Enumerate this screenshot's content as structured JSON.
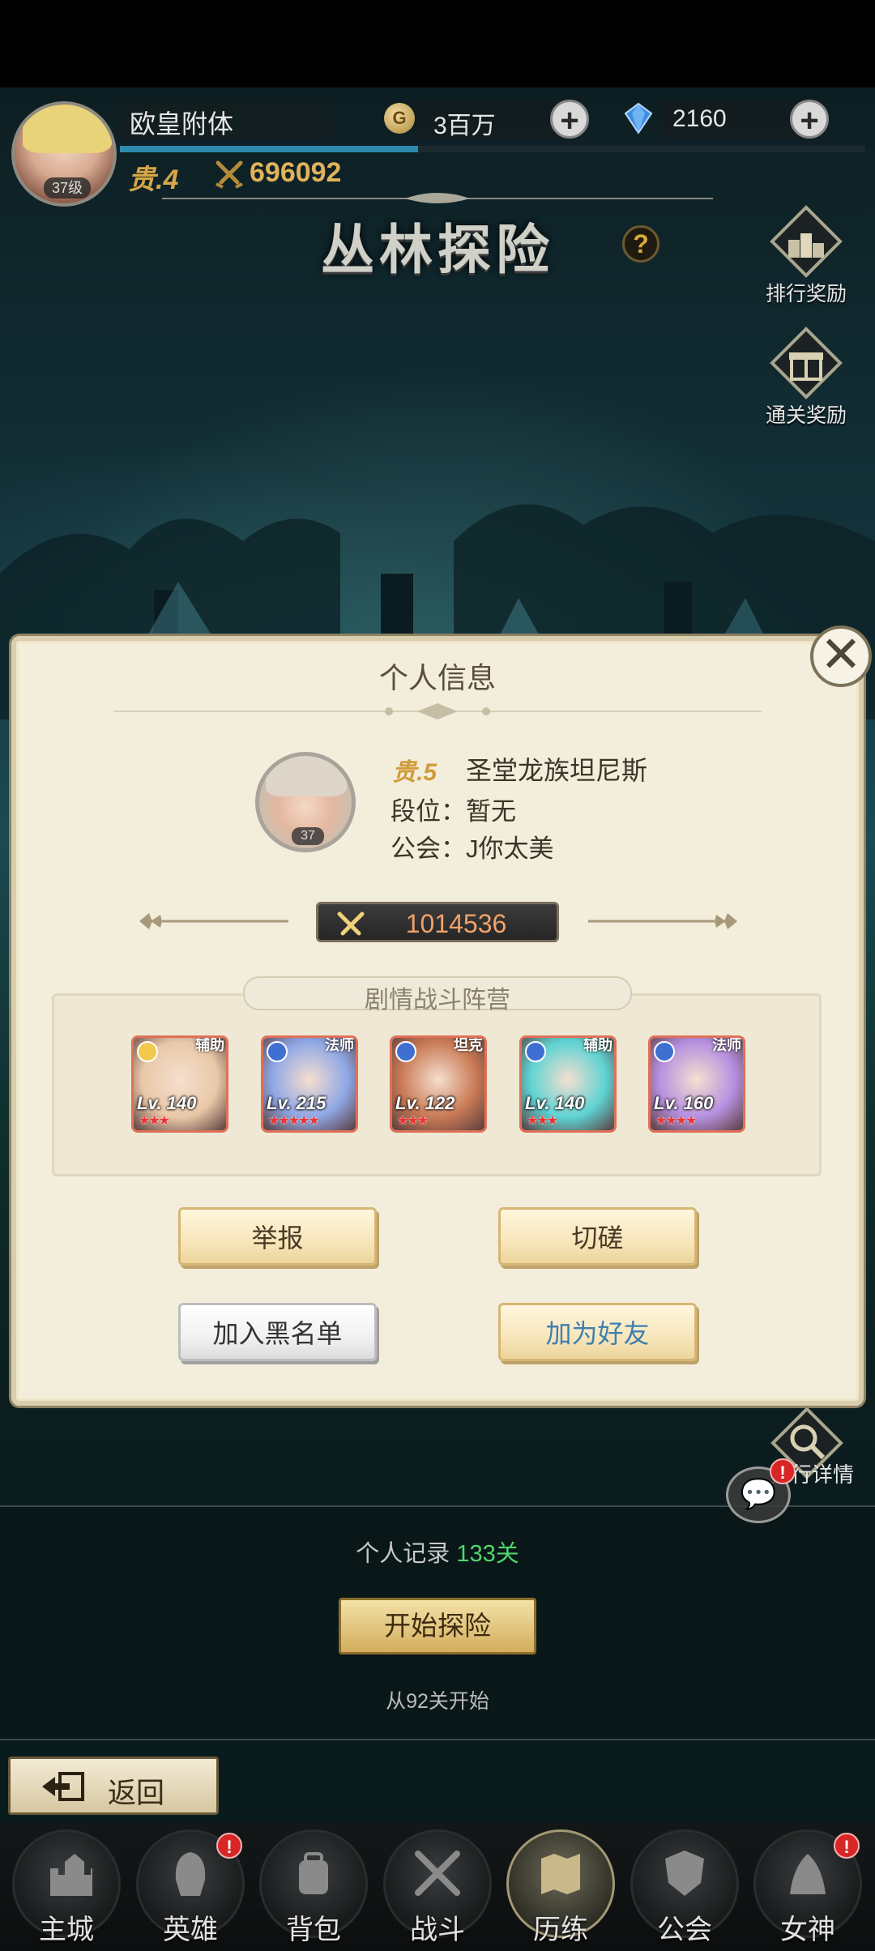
{
  "header": {
    "player_name": "欧皇附体",
    "avatar_level": "37级",
    "vip": "贵.4",
    "power": "696092",
    "gold": "3百万",
    "gold_icon": "G",
    "diamonds": "2160",
    "exp_progress": 0.4
  },
  "page": {
    "title": "丛林探险",
    "help": "?",
    "side_buttons": [
      "排行奖励",
      "通关奖励"
    ]
  },
  "modal": {
    "title": "个人信息",
    "player": {
      "vip": "贵.5",
      "name": "圣堂龙族坦尼斯",
      "rank_label": "段位：暂无",
      "guild_label": "公会：J你太美",
      "avatar_level": "37"
    },
    "power": "1014536",
    "lineup_title": "剧情战斗阵营",
    "heroes": [
      {
        "role": "辅助",
        "level": "Lv. 140",
        "stars": "★★★",
        "color": "#e9c8a8"
      },
      {
        "role": "法师",
        "level": "Lv. 215",
        "stars": "★★★★★",
        "color": "#8fa7e6"
      },
      {
        "role": "坦克",
        "level": "Lv. 122",
        "stars": "★★★",
        "color": "#c97a55"
      },
      {
        "role": "辅助",
        "level": "Lv. 140",
        "stars": "★★★",
        "color": "#5fd3d3"
      },
      {
        "role": "法师",
        "level": "Lv. 160",
        "stars": "★★★★",
        "color": "#b690e0"
      }
    ],
    "buttons": {
      "report": "举报",
      "spar": "切磋",
      "blacklist": "加入黑名单",
      "add_friend": "加为好友"
    }
  },
  "lower": {
    "record_label": "个人记录",
    "record_value": "133关",
    "start_button": "开始探险",
    "start_hint": "从92关开始",
    "detail_label": "排行详情",
    "back": "返回"
  },
  "tabs": [
    "主城",
    "英雄",
    "背包",
    "战斗",
    "历练",
    "公会",
    "女神"
  ],
  "badge": "!"
}
